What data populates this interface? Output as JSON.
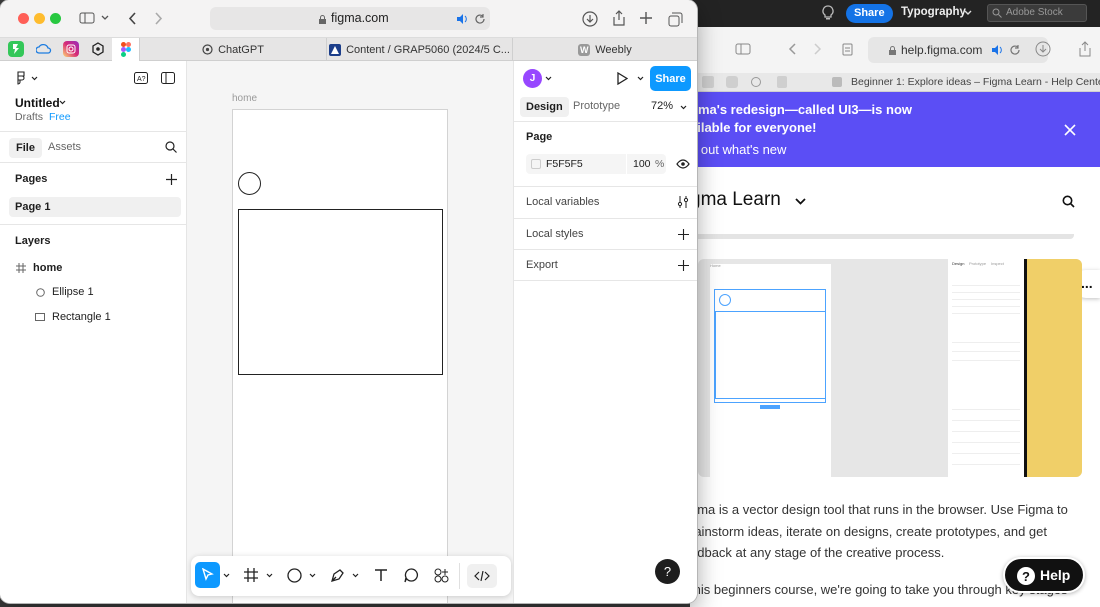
{
  "menubar": {
    "share_label": "Share",
    "typography_label": "Typography",
    "search_placeholder": "Adobe Stock"
  },
  "left_browser": {
    "url": "figma.com",
    "tabs": [
      {
        "label": "ChatGPT"
      },
      {
        "label": "Content / GRAP5060 (2024/5 C..."
      },
      {
        "label": "Weebly"
      }
    ]
  },
  "figma": {
    "file_name": "Untitled",
    "drafts_label": "Drafts",
    "plan_label": "Free",
    "file_tab": "File",
    "assets_tab": "Assets",
    "pages_heading": "Pages",
    "current_page": "Page 1",
    "layers_heading": "Layers",
    "layers": [
      {
        "name": "home",
        "icon": "frame-icon"
      },
      {
        "name": "Ellipse 1",
        "icon": "ellipse-icon"
      },
      {
        "name": "Rectangle 1",
        "icon": "rectangle-icon"
      }
    ],
    "frame_label": "home",
    "avatar_initial": "J",
    "share_label": "Share",
    "design_tab": "Design",
    "prototype_tab": "Prototype",
    "zoom": "72%",
    "page_heading": "Page",
    "bg_color": "F5F5F5",
    "bg_opacity": "100",
    "percent_sign": "%",
    "local_variables": "Local variables",
    "local_styles": "Local styles",
    "export": "Export",
    "help_label": "?"
  },
  "right_browser": {
    "url": "help.figma.com",
    "tab_title": "Beginner 1: Explore ideas – Figma Learn - Help Center",
    "banner_line1": "gma's redesign—called UI3—is now",
    "banner_line2": "ailable for everyone!",
    "banner_link": "d out what's new",
    "learn_title": "gma Learn",
    "body_line1": "gma is a vector design tool that runs in the browser. Use Figma to",
    "body_line2": "rainstorm ideas, iterate on designs, create prototypes, and get",
    "body_line3": "edback at any stage of the creative process.",
    "body_line4": "this beginners course, we're going to take you through key stages",
    "help_button": "Help",
    "more_label": "...",
    "thumb_labels": {
      "design": "Design",
      "prototype": "Prototype",
      "inspect": "Inspect",
      "home": "Home"
    }
  },
  "colors": {
    "accent": "#0d99ff",
    "banner": "#5b4ef5",
    "avatar": "#9747ff",
    "help_button": "#111111"
  }
}
